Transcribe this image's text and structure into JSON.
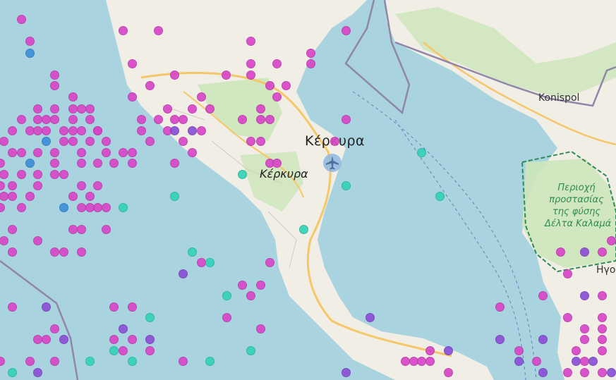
{
  "map": {
    "labels": {
      "kerkyra_city": "Κέρκυρα",
      "kerkyra_island": "Κέρκυρα",
      "konispol": "Konispol",
      "park_line1": "Περιοχή",
      "park_line2": "προστασίας",
      "park_line3": "της φύσης",
      "park_line4": "Δέλτα Καλαμά",
      "edge_town": "Ηγο"
    },
    "colors": {
      "sea": "#a9d3df",
      "land": "#f1eee6",
      "forest": "#cde5ba",
      "road": "#f6c768",
      "border": "#8f86a8",
      "magenta": "#d946c8",
      "violet": "#8b4fd6",
      "teal": "#34d3b9",
      "blue": "#3d8fd9"
    },
    "icons": {
      "airport": "airplane-icon"
    }
  }
}
